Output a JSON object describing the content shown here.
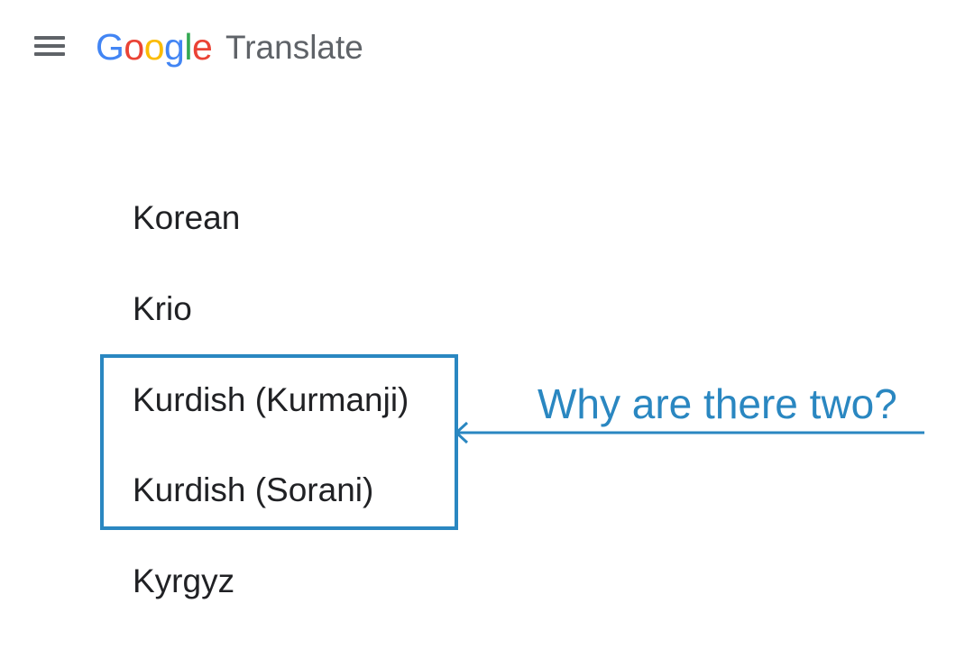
{
  "header": {
    "menu_icon": "hamburger-menu-icon",
    "logo_letters": [
      "G",
      "o",
      "o",
      "g",
      "l",
      "e"
    ],
    "product_name": "Translate"
  },
  "language_list": {
    "items": [
      "Korean",
      "Krio",
      "Kurdish (Kurmanji)",
      "Kurdish (Sorani)",
      "Kyrgyz"
    ]
  },
  "annotation": {
    "text": "Why are there two?",
    "color": "#2a87c1"
  },
  "colors": {
    "google_blue": "#4285f4",
    "google_red": "#ea4335",
    "google_yellow": "#fbbc05",
    "google_green": "#34a853",
    "text_primary": "#202124",
    "text_secondary": "#5f6368"
  }
}
